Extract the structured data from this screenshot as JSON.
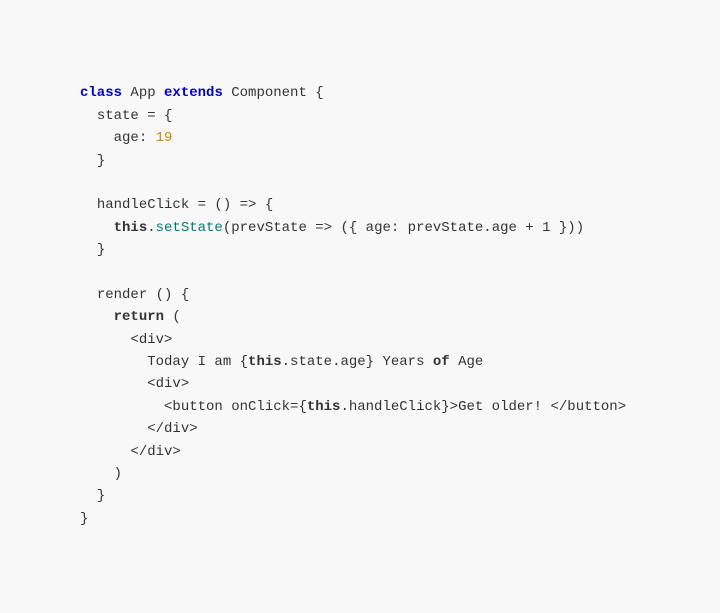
{
  "code": {
    "lines": [
      {
        "type": "mixed"
      },
      {
        "type": "plain",
        "text": "  state = {"
      },
      {
        "type": "mixed"
      },
      {
        "type": "plain",
        "text": "  }"
      },
      {
        "type": "plain",
        "text": ""
      },
      {
        "type": "mixed"
      },
      {
        "type": "mixed"
      },
      {
        "type": "plain",
        "text": "  }"
      },
      {
        "type": "plain",
        "text": ""
      },
      {
        "type": "mixed"
      },
      {
        "type": "mixed"
      },
      {
        "type": "mixed"
      },
      {
        "type": "mixed"
      },
      {
        "type": "mixed"
      },
      {
        "type": "mixed"
      },
      {
        "type": "mixed"
      },
      {
        "type": "plain",
        "text": "    )"
      },
      {
        "type": "plain",
        "text": "  }"
      },
      {
        "type": "plain",
        "text": "}"
      }
    ]
  }
}
